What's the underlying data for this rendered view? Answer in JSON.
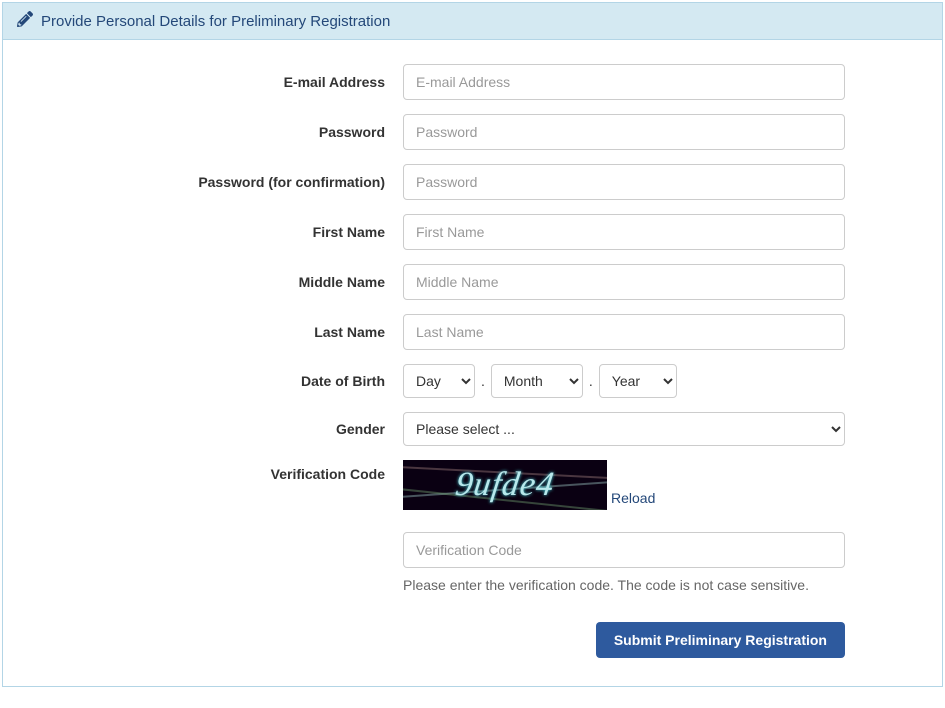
{
  "panel": {
    "title": "Provide Personal Details for Preliminary Registration"
  },
  "form": {
    "email": {
      "label": "E-mail Address",
      "placeholder": "E-mail Address"
    },
    "password": {
      "label": "Password",
      "placeholder": "Password"
    },
    "password_confirm": {
      "label": "Password (for confirmation)",
      "placeholder": "Password"
    },
    "first_name": {
      "label": "First Name",
      "placeholder": "First Name"
    },
    "middle_name": {
      "label": "Middle Name",
      "placeholder": "Middle Name"
    },
    "last_name": {
      "label": "Last Name",
      "placeholder": "Last Name"
    },
    "dob": {
      "label": "Date of Birth",
      "day": "Day",
      "month": "Month",
      "year": "Year",
      "separator": "."
    },
    "gender": {
      "label": "Gender",
      "placeholder": "Please select ..."
    },
    "verification": {
      "label": "Verification Code",
      "captcha_text": "9ufde4",
      "reload": "Reload",
      "placeholder": "Verification Code",
      "help": "Please enter the verification code. The code is not case sensitive."
    }
  },
  "buttons": {
    "submit": "Submit Preliminary Registration"
  }
}
